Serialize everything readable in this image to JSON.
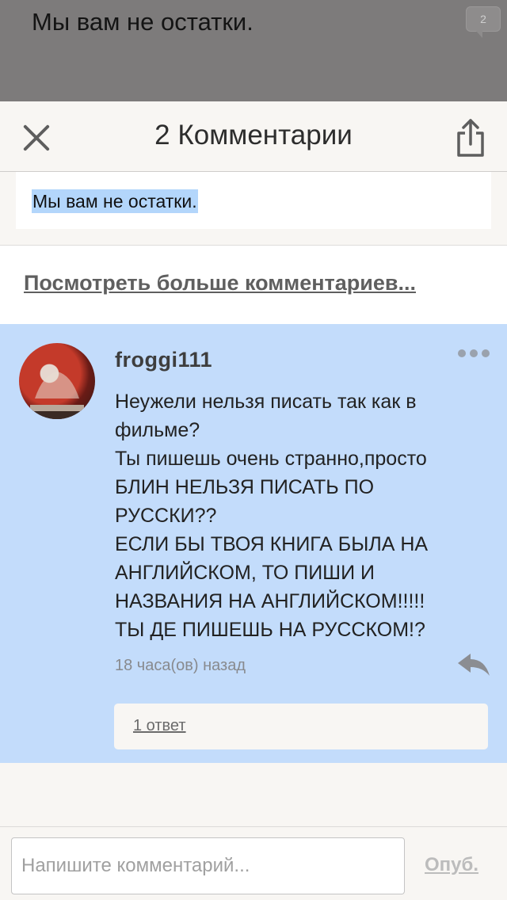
{
  "background_page": {
    "title": "Мы вам не остатки.",
    "comment_badge_count": "2"
  },
  "header": {
    "title": "2 Комментарии",
    "close_icon": "close-icon",
    "share_icon": "share-icon"
  },
  "quote": {
    "text": "Мы вам не остатки.",
    "highlight_color": "#b3d6fb"
  },
  "view_more": {
    "label": "Посмотреть больше комментариев..."
  },
  "comment": {
    "username": "froggi111",
    "body": "Неужели нельзя писать так как в фильме?\nТы пишешь очень странно,просто БЛИН НЕЛЬЗЯ ПИСАТЬ ПО РУССКИ??\nЕСЛИ БЫ ТВОЯ КНИГА БЫЛА НА АНГЛИЙСКОМ, ТО ПИШИ И НАЗВАНИЯ НА АНГЛИЙСКОМ!!!!!\nТЫ ДЕ ПИШЕШЬ НА РУССКОМ!?",
    "timestamp": "18 часа(ов) назад",
    "replies_label": "1 ответ",
    "background_color": "#c3dcfb",
    "more_icon": "more-dots-icon",
    "reply_icon": "reply-icon"
  },
  "footer": {
    "input_placeholder": "Напишите комментарий...",
    "input_value": "",
    "publish_label": "Опуб."
  }
}
